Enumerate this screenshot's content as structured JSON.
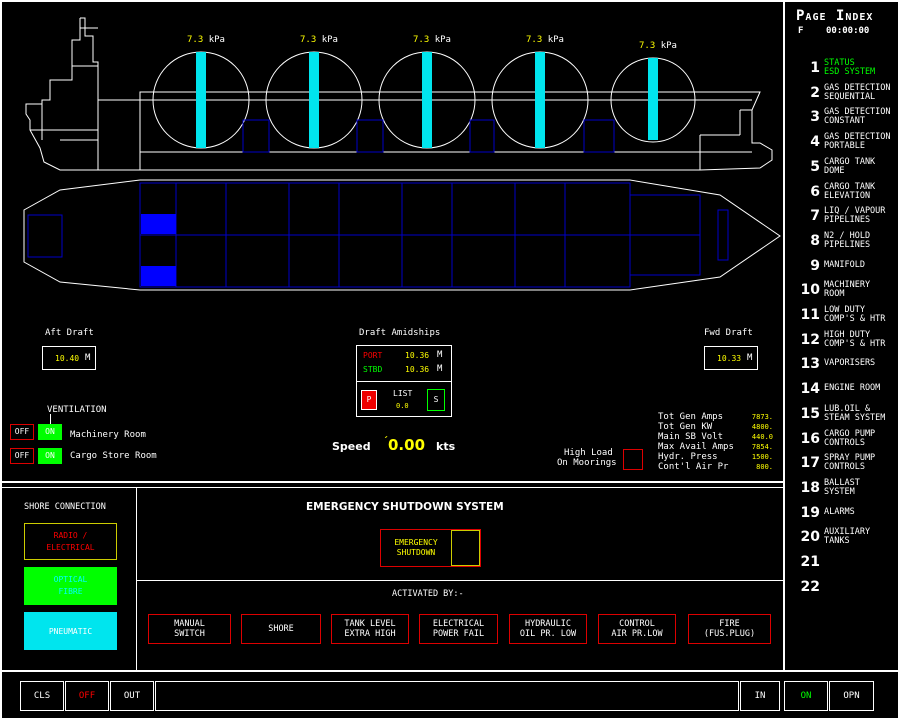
{
  "page_index": {
    "title": "Page Index",
    "sub_letter": "F",
    "clock": "00:00:00",
    "items": [
      {
        "num": "1",
        "label": "STATUS\nESD SYSTEM",
        "active": true
      },
      {
        "num": "2",
        "label": "GAS DETECTION\nSEQUENTIAL"
      },
      {
        "num": "3",
        "label": "GAS DETECTION\nCONSTANT"
      },
      {
        "num": "4",
        "label": "GAS DETECTION\nPORTABLE"
      },
      {
        "num": "5",
        "label": "CARGO TANK\nDOME"
      },
      {
        "num": "6",
        "label": "CARGO TANK\nELEVATION"
      },
      {
        "num": "7",
        "label": "LIQ / VAPOUR\nPIPELINES"
      },
      {
        "num": "8",
        "label": "N2 / HOLD\nPIPELINES"
      },
      {
        "num": "9",
        "label": "MANIFOLD"
      },
      {
        "num": "10",
        "label": "MACHINERY\nROOM"
      },
      {
        "num": "11",
        "label": "LOW DUTY\nCOMP'S & HTR"
      },
      {
        "num": "12",
        "label": "HIGH DUTY\nCOMP'S & HTR"
      },
      {
        "num": "13",
        "label": "VAPORISERS"
      },
      {
        "num": "14",
        "label": "ENGINE ROOM"
      },
      {
        "num": "15",
        "label": "LUB.OIL &\nSTEAM SYSTEM"
      },
      {
        "num": "16",
        "label": "CARGO PUMP\nCONTROLS"
      },
      {
        "num": "17",
        "label": "SPRAY PUMP\nCONTROLS"
      },
      {
        "num": "18",
        "label": "BALLAST\nSYSTEM"
      },
      {
        "num": "19",
        "label": "ALARMS"
      },
      {
        "num": "20",
        "label": "AUXILIARY\nTANKS"
      },
      {
        "num": "21",
        "label": ""
      },
      {
        "num": "22",
        "label": ""
      }
    ]
  },
  "tanks": [
    {
      "value": "7.3",
      "unit": "kPa"
    },
    {
      "value": "7.3",
      "unit": "kPa"
    },
    {
      "value": "7.3",
      "unit": "kPa"
    },
    {
      "value": "7.3",
      "unit": "kPa"
    },
    {
      "value": "7.3",
      "unit": "kPa"
    }
  ],
  "drafts": {
    "aft_label": "Aft Draft",
    "aft_value": "10.40",
    "fwd_label": "Fwd Draft",
    "fwd_value": "10.33",
    "unit": "M",
    "amidships_label": "Draft Amidships",
    "port_label": "PORT",
    "port_value": "10.36",
    "stbd_label": "STBD",
    "stbd_value": "10.36",
    "list_label": "LIST",
    "list_value": "0.0",
    "p_label": "P",
    "s_label": "S"
  },
  "ventilation": {
    "title": "VENTILATION",
    "off": "OFF",
    "on": "ON",
    "rows": [
      "Machinery Room",
      "Cargo Store Room"
    ]
  },
  "speed": {
    "label": "Speed",
    "value": "0.00",
    "unit": "kts"
  },
  "high_load": {
    "line1": "High Load",
    "line2": "On Moorings"
  },
  "generator": [
    {
      "label": "Tot Gen Amps",
      "value": "7873."
    },
    {
      "label": "Tot Gen KW",
      "value": "4800."
    },
    {
      "label": "Main SB Volt",
      "value": "440.0"
    },
    {
      "label": "Max Avail Amps",
      "value": "7854."
    },
    {
      "label": "Hydr. Press",
      "value": "1500."
    },
    {
      "label": "Cont'l Air Pr",
      "value": "800."
    }
  ],
  "shore": {
    "title": "SHORE CONNECTION",
    "radio": "RADIO /\nELECTRICAL",
    "optical": "OPTICAL\nFIBRE",
    "pneumatic": "PNEUMATIC"
  },
  "esd": {
    "title": "EMERGENCY SHUTDOWN SYSTEM",
    "button": "EMERGENCY\nSHUTDOWN",
    "activated_by": "ACTIVATED BY:-",
    "causes": [
      "MANUAL\nSWITCH",
      "SHORE",
      "TANK LEVEL\nEXTRA HIGH",
      "ELECTRICAL\nPOWER FAIL",
      "HYDRAULIC\nOIL PR. LOW",
      "CONTROL\nAIR PR.LOW",
      "FIRE\n(FUS.PLUG)"
    ]
  },
  "bottom_bar": {
    "cls": "CLS",
    "off": "OFF",
    "out": "OUT",
    "in": "IN",
    "on": "ON",
    "opn": "OPN"
  },
  "colors": {
    "tank_fill": "#00e5ee",
    "hold_blue": "#0000c8",
    "on_green": "#00ff00",
    "alarm_red": "#dd0000",
    "value_yellow": "#ffff00"
  }
}
